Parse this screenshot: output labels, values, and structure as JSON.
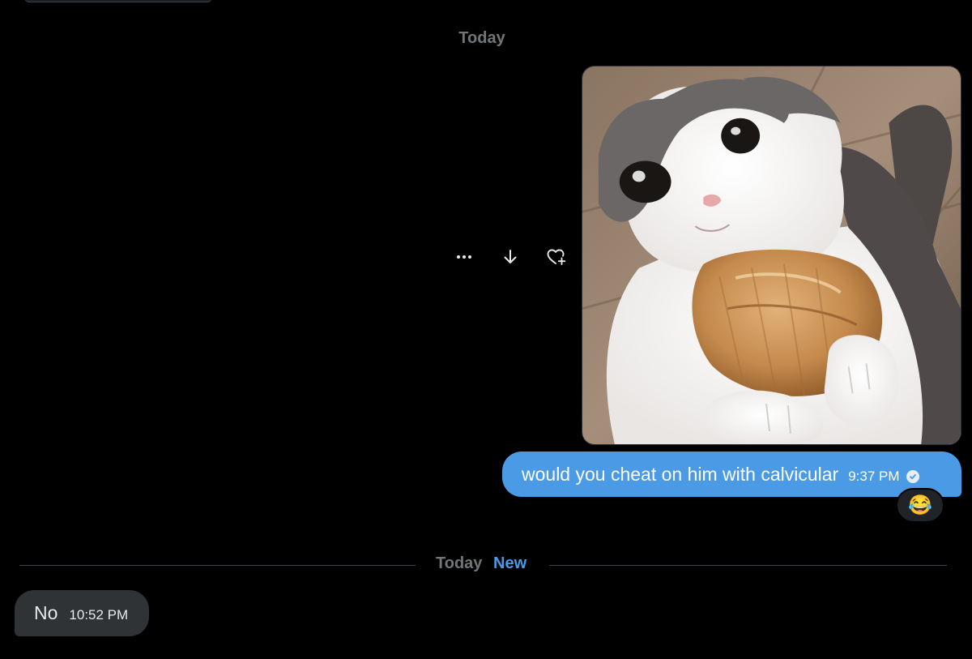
{
  "conversation": {
    "date_divider_top": "Today",
    "sent_message": {
      "text": "would you cheat on him with calvicular",
      "time": "9:37 PM",
      "status_icon": "read-check-icon",
      "reaction": "😂"
    },
    "media_actions": [
      {
        "icon": "more-icon"
      },
      {
        "icon": "download-icon"
      },
      {
        "icon": "add-reaction-icon"
      }
    ],
    "new_divider": {
      "date": "Today",
      "label": "New"
    },
    "received_message": {
      "text": "No",
      "time": "10:52 PM"
    }
  },
  "colors": {
    "background": "#000000",
    "accent": "#4a9ae6",
    "received_bubble": "#2f3336",
    "muted_text": "#71767b"
  }
}
